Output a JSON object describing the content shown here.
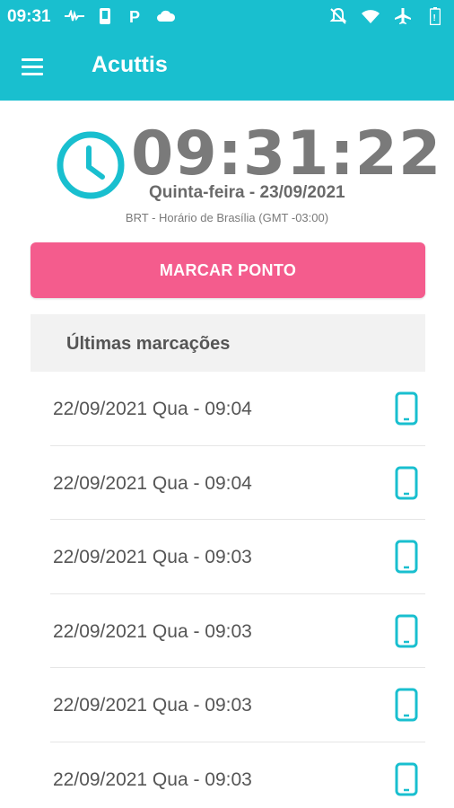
{
  "status_bar": {
    "time": "09:31",
    "icons_left": [
      "pulse-icon",
      "phone-icon",
      "parking-icon",
      "cloud-icon"
    ],
    "icons_right": [
      "notifications-off-icon",
      "wifi-icon",
      "airplane-icon",
      "battery-icon"
    ]
  },
  "app_bar": {
    "title": "Acuttis",
    "menu_icon": "menu-icon"
  },
  "clock": {
    "time": "09:31:22",
    "date": "Quinta-feira - 23/09/2021",
    "timezone": "BRT - Horário de Brasília (GMT -03:00)"
  },
  "actions": {
    "mark_label": "MARCAR PONTO"
  },
  "colors": {
    "primary": "#19bfcf",
    "accent": "#f45c8d"
  },
  "history": {
    "title": "Últimas marcações",
    "items": [
      {
        "label": "22/09/2021 Qua - 09:04",
        "icon": "smartphone-icon"
      },
      {
        "label": "22/09/2021 Qua - 09:04",
        "icon": "smartphone-icon"
      },
      {
        "label": "22/09/2021 Qua - 09:03",
        "icon": "smartphone-icon"
      },
      {
        "label": "22/09/2021 Qua - 09:03",
        "icon": "smartphone-icon"
      },
      {
        "label": "22/09/2021 Qua - 09:03",
        "icon": "smartphone-icon"
      },
      {
        "label": "22/09/2021 Qua - 09:03",
        "icon": "smartphone-icon"
      }
    ]
  }
}
